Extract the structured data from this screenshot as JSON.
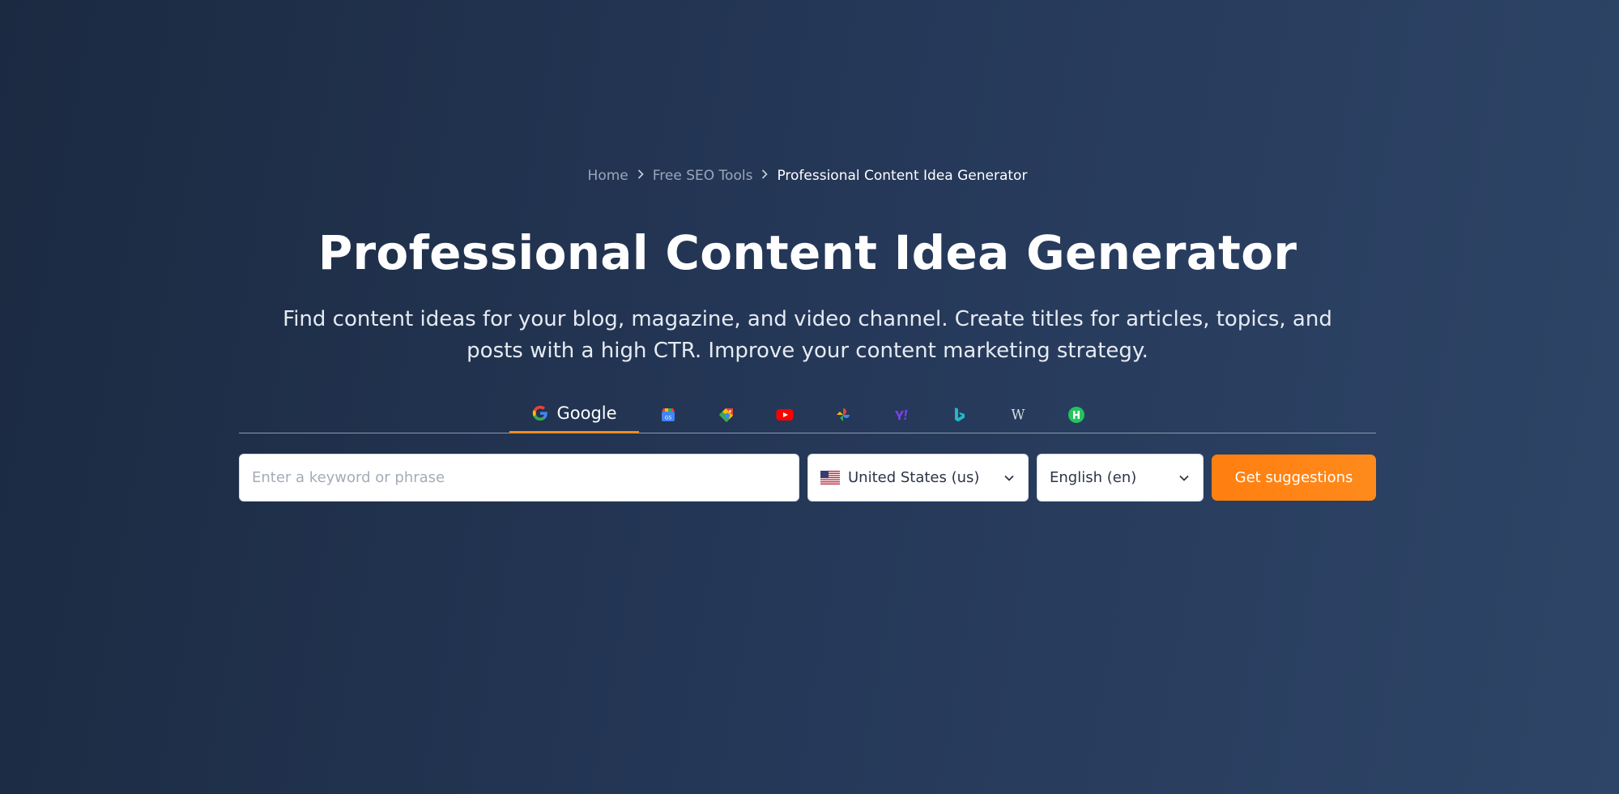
{
  "breadcrumb": {
    "items": [
      {
        "label": "Home"
      },
      {
        "label": "Free SEO Tools"
      },
      {
        "label": "Professional Content Idea Generator"
      }
    ]
  },
  "header": {
    "title": "Professional Content Idea Generator",
    "subtitle": "Find content ideas for your blog, magazine, and video channel. Create titles for articles, topics, and posts with a high CTR. Improve your content marketing strategy."
  },
  "tabs": [
    {
      "label": "Google",
      "icon": "google-icon",
      "active": true
    },
    {
      "icon": "google-play-store-icon"
    },
    {
      "icon": "google-shopping-icon"
    },
    {
      "icon": "youtube-icon"
    },
    {
      "icon": "pinwheel-icon"
    },
    {
      "icon": "yahoo-icon"
    },
    {
      "icon": "bing-icon"
    },
    {
      "icon": "wikipedia-icon"
    },
    {
      "icon": "green-badge-icon"
    }
  ],
  "form": {
    "keyword_placeholder": "Enter a keyword or phrase",
    "country": {
      "value": "United States (us)",
      "flag": "us-flag-icon"
    },
    "language": {
      "value": "English (en)"
    },
    "submit_label": "Get suggestions"
  },
  "colors": {
    "accent": "#ff7f0f",
    "tab_underline": "#f28c1e",
    "bg_start": "#1b2a41",
    "bg_end": "#2e4567"
  }
}
